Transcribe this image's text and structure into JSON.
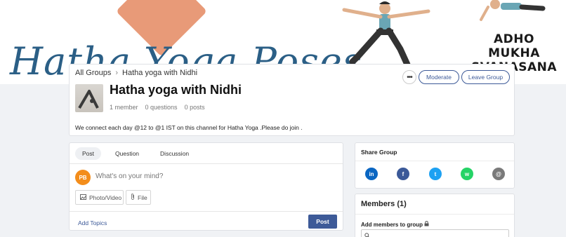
{
  "banner": {
    "script_text": "Hatha Yoga Poses",
    "pose_label_line1": "ADHO MUKHA",
    "pose_label_line2": "SVANASANA"
  },
  "breadcrumb": {
    "root": "All Groups",
    "current": "Hatha yoga with Nidhi"
  },
  "group": {
    "title": "Hatha yoga with Nidhi",
    "members": "1 member",
    "questions": "0 questions",
    "posts": "0 posts",
    "description": "We connect each day @12 to @1 IST on this channel for Hatha Yoga .Please do join ."
  },
  "actions": {
    "more": "•••",
    "moderate": "Moderate",
    "leave": "Leave Group"
  },
  "composer": {
    "tabs": [
      {
        "label": "Post",
        "active": true
      },
      {
        "label": "Question",
        "active": false
      },
      {
        "label": "Discussion",
        "active": false
      }
    ],
    "avatar_initials": "PB",
    "placeholder": "What's on your mind?",
    "photo_video": "Photo/Video",
    "file": "File",
    "add_topics": "Add Topics",
    "post_button": "Post"
  },
  "share": {
    "title": "Share Group",
    "icons": [
      {
        "name": "linkedin-icon",
        "glyph": "in",
        "color": "#0a66c2"
      },
      {
        "name": "facebook-icon",
        "glyph": "f",
        "color": "#3b5998"
      },
      {
        "name": "twitter-icon",
        "glyph": "t",
        "color": "#1da1f2"
      },
      {
        "name": "whatsapp-icon",
        "glyph": "w",
        "color": "#25d366"
      },
      {
        "name": "email-icon",
        "glyph": "@",
        "color": "#7a7a7a"
      }
    ]
  },
  "members": {
    "title": "Members (1)",
    "add_label": "Add members to group"
  },
  "colors": {
    "accent": "#3d5a98",
    "avatar": "#f38d1b"
  }
}
